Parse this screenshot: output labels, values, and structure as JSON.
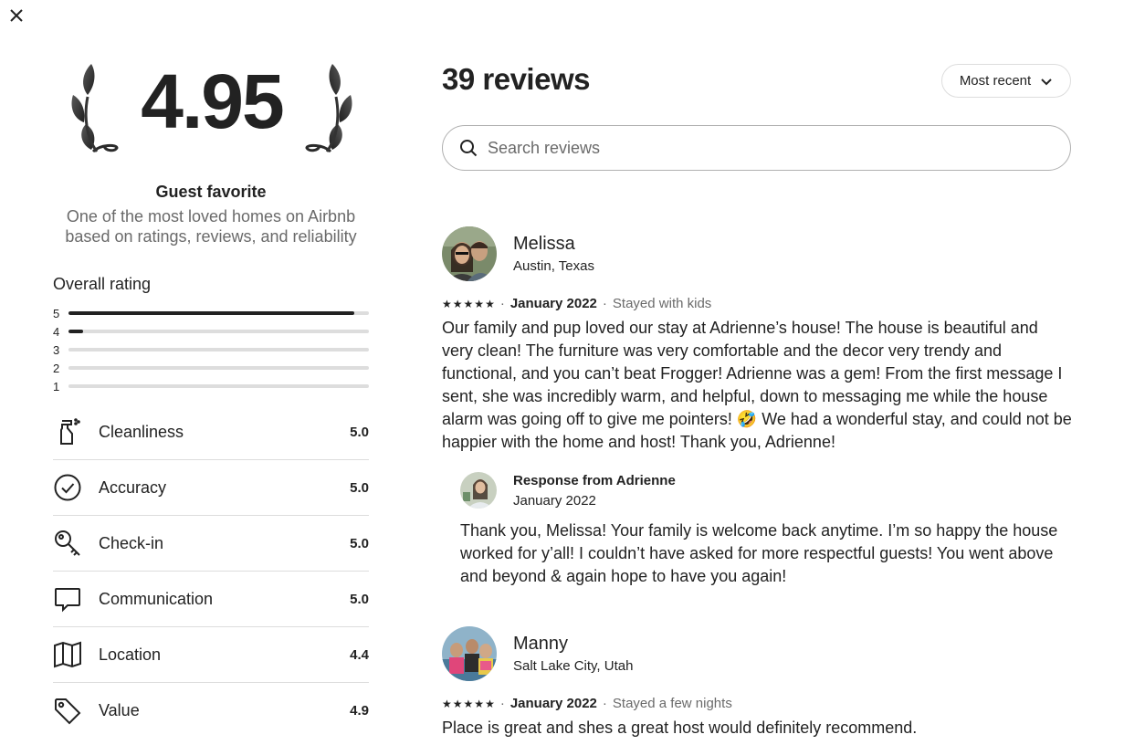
{
  "modal": {
    "close_label": "Close"
  },
  "summary": {
    "score": "4.95",
    "badge_title": "Guest favorite",
    "badge_subtitle": "One of the most loved homes on Airbnb based on ratings, reviews, and reliability"
  },
  "overall_rating": {
    "title": "Overall rating",
    "distribution": [
      {
        "stars": "5",
        "share": 0.95
      },
      {
        "stars": "4",
        "share": 0.05
      },
      {
        "stars": "3",
        "share": 0.0
      },
      {
        "stars": "2",
        "share": 0.0
      },
      {
        "stars": "1",
        "share": 0.0
      }
    ]
  },
  "categories": [
    {
      "label": "Cleanliness",
      "score": "5.0",
      "icon": "spray-bottle-icon"
    },
    {
      "label": "Accuracy",
      "score": "5.0",
      "icon": "check-circle-icon"
    },
    {
      "label": "Check-in",
      "score": "5.0",
      "icon": "key-icon"
    },
    {
      "label": "Communication",
      "score": "5.0",
      "icon": "chat-bubble-icon"
    },
    {
      "label": "Location",
      "score": "4.4",
      "icon": "map-icon"
    },
    {
      "label": "Value",
      "score": "4.9",
      "icon": "tag-icon"
    }
  ],
  "reviews_header": {
    "title": "39 reviews",
    "sort_label": "Most recent",
    "search_placeholder": "Search reviews"
  },
  "reviews": [
    {
      "name": "Melissa",
      "location": "Austin, Texas",
      "rating": 5,
      "date": "January 2022",
      "stay": "Stayed with kids",
      "text": "Our family and pup loved our stay at Adrienne’s house! The house is beautiful and very clean! The furniture was very comfortable and the decor very trendy and functional, and you can’t beat Frogger! Adrienne was a gem! From the first message I sent, she was incredibly warm, and helpful, down to messaging me while the house alarm was going off to give me pointers! 🤣 We had a wonderful stay, and could not be happier with the home and host! Thank you, Adrienne!",
      "response": {
        "title": "Response from Adrienne",
        "date": "January 2022",
        "text": "Thank you, Melissa! Your family is welcome back anytime. I’m so happy the house worked for y’all! I couldn’t have asked for more respectful guests! You went above and beyond & again hope to have you again!"
      }
    },
    {
      "name": "Manny",
      "location": "Salt Lake City, Utah",
      "rating": 5,
      "date": "January 2022",
      "stay": "Stayed a few nights",
      "text": "Place is great and shes a great host would definitely recommend."
    }
  ],
  "colors": {
    "text": "#222222",
    "muted": "#6a6a6a",
    "divider": "#dddddd"
  }
}
